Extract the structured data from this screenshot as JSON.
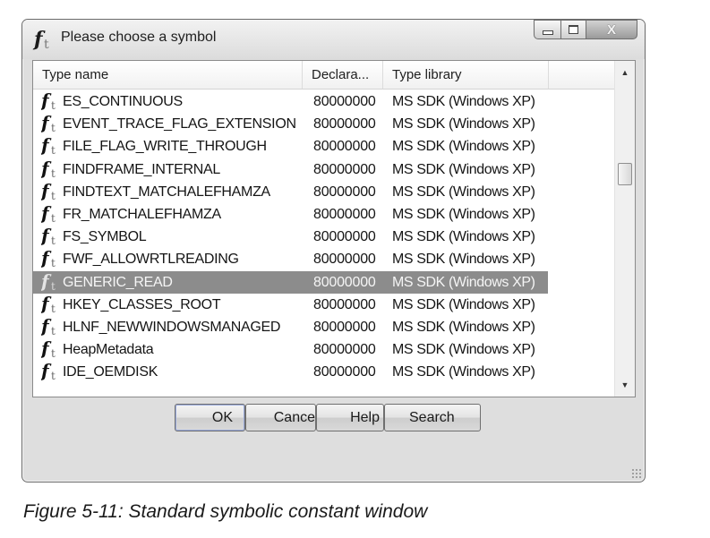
{
  "window": {
    "title": "Please choose a symbol",
    "title_icon": "function-symbol-icon",
    "close_glyph": "X"
  },
  "table": {
    "columns": [
      "Type name",
      "Declara...",
      "Type library"
    ],
    "rows": [
      {
        "name": "ES_CONTINUOUS",
        "declaration": "80000000",
        "library": "MS SDK (Windows XP)"
      },
      {
        "name": "EVENT_TRACE_FLAG_EXTENSION",
        "declaration": "80000000",
        "library": "MS SDK (Windows XP)"
      },
      {
        "name": "FILE_FLAG_WRITE_THROUGH",
        "declaration": "80000000",
        "library": "MS SDK (Windows XP)"
      },
      {
        "name": "FINDFRAME_INTERNAL",
        "declaration": "80000000",
        "library": "MS SDK (Windows XP)"
      },
      {
        "name": "FINDTEXT_MATCHALEFHAMZA",
        "declaration": "80000000",
        "library": "MS SDK (Windows XP)"
      },
      {
        "name": "FR_MATCHALEFHAMZA",
        "declaration": "80000000",
        "library": "MS SDK (Windows XP)"
      },
      {
        "name": "FS_SYMBOL",
        "declaration": "80000000",
        "library": "MS SDK (Windows XP)"
      },
      {
        "name": "FWF_ALLOWRTLREADING",
        "declaration": "80000000",
        "library": "MS SDK (Windows XP)"
      },
      {
        "name": "GENERIC_READ",
        "declaration": "80000000",
        "library": "MS SDK (Windows XP)",
        "selected": true
      },
      {
        "name": "HKEY_CLASSES_ROOT",
        "declaration": "80000000",
        "library": "MS SDK (Windows XP)"
      },
      {
        "name": "HLNF_NEWWINDOWSMANAGED",
        "declaration": "80000000",
        "library": "MS SDK (Windows XP)"
      },
      {
        "name": "HeapMetadata",
        "declaration": "80000000",
        "library": "MS SDK (Windows XP)"
      },
      {
        "name": "IDE_OEMDISK",
        "declaration": "80000000",
        "library": "MS SDK (Windows XP)"
      }
    ]
  },
  "buttons": {
    "ok": "OK",
    "cancel": "Cance",
    "help": "Help",
    "search": "Search"
  },
  "caption": "Figure 5-11: Standard symbolic constant window",
  "colors": {
    "selection": "#8c8c8c",
    "window_bg": "#dedede"
  }
}
